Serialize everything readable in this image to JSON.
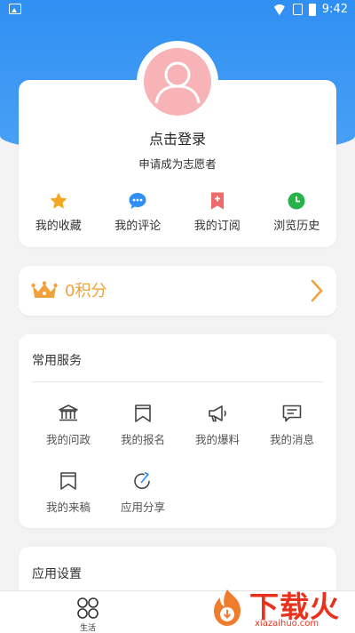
{
  "status_bar": {
    "time": "9:42"
  },
  "profile": {
    "login_text": "点击登录",
    "volunteer_text": "申请成为志愿者",
    "quick_actions": [
      {
        "label": "我的收藏",
        "icon": "star-icon",
        "color": "#f5a623"
      },
      {
        "label": "我的评论",
        "icon": "comment-icon",
        "color": "#2f8ff2"
      },
      {
        "label": "我的订阅",
        "icon": "bookmark-plus-icon",
        "color": "#ef6a6a"
      },
      {
        "label": "浏览历史",
        "icon": "clock-icon",
        "color": "#27b24a"
      }
    ]
  },
  "points": {
    "label": "0积分",
    "color": "#f0a33b"
  },
  "services": {
    "title": "常用服务",
    "items": [
      {
        "label": "我的问政",
        "icon": "government-building-icon"
      },
      {
        "label": "我的报名",
        "icon": "ribbon-flag-icon"
      },
      {
        "label": "我的爆料",
        "icon": "megaphone-icon"
      },
      {
        "label": "我的消息",
        "icon": "message-icon"
      },
      {
        "label": "我的来稿",
        "icon": "manuscript-ribbon-icon"
      },
      {
        "label": "应用分享",
        "icon": "share-icon"
      }
    ]
  },
  "settings": {
    "title": "应用设置"
  },
  "tabbar": {
    "items": [
      {
        "label": "生活",
        "icon": "four-circles-icon"
      }
    ]
  },
  "watermark": {
    "text": "下载火",
    "url": "xiazaihuo.com"
  }
}
